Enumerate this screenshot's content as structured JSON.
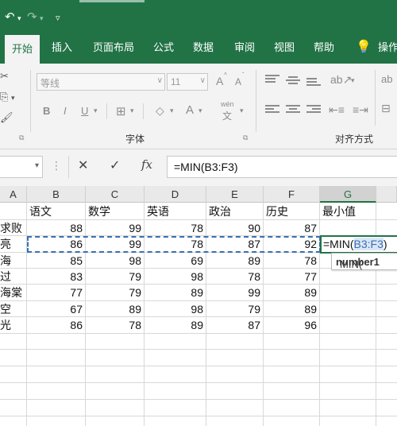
{
  "quick_access": {
    "undo_icon": "undo-icon",
    "redo_icon": "redo-icon",
    "customize_icon": "customize-icon"
  },
  "tabs": [
    "开始",
    "插入",
    "页面布局",
    "公式",
    "数据",
    "审阅",
    "视图",
    "帮助",
    "操作"
  ],
  "active_tab": "开始",
  "ribbon": {
    "font_name": "等线",
    "font_size": "11",
    "font_group_label": "字体",
    "alignment_group_label": "对齐方式",
    "bold": "B",
    "italic": "I",
    "underline": "U",
    "grow_font": "A",
    "shrink_font": "A",
    "font_color": "A",
    "phonetic": "wén"
  },
  "formula_bar": {
    "name_box": "",
    "formula": "=MIN(B3:F3)",
    "cancel_icon": "close-icon",
    "enter_icon": "check-icon",
    "fx_label": "fx"
  },
  "columns": [
    "A",
    "B",
    "C",
    "D",
    "E",
    "F",
    "G"
  ],
  "header_row": [
    "",
    "语文",
    "数学",
    "英语",
    "政治",
    "历史",
    "最小值"
  ],
  "rows": [
    {
      "name": "求败",
      "values": [
        "88",
        "99",
        "78",
        "90",
        "87"
      ]
    },
    {
      "name": "亮",
      "values": [
        "86",
        "99",
        "78",
        "87",
        "92"
      ]
    },
    {
      "name": "海",
      "values": [
        "85",
        "98",
        "69",
        "89",
        "78"
      ]
    },
    {
      "name": "过",
      "values": [
        "83",
        "79",
        "98",
        "78",
        "77"
      ]
    },
    {
      "name": "海棠",
      "values": [
        "77",
        "79",
        "89",
        "99",
        "89"
      ]
    },
    {
      "name": "空",
      "values": [
        "67",
        "89",
        "98",
        "79",
        "89"
      ]
    },
    {
      "name": "光",
      "values": [
        "86",
        "78",
        "89",
        "87",
        "96"
      ]
    }
  ],
  "editing_cell": {
    "prefix": "=MIN(",
    "ref": "B3:F3",
    "suffix": ")"
  },
  "tooltip": {
    "func": "MIN(",
    "arg": "number1"
  },
  "colors": {
    "brand": "#217346",
    "ref_blue": "#3a6fb5"
  }
}
